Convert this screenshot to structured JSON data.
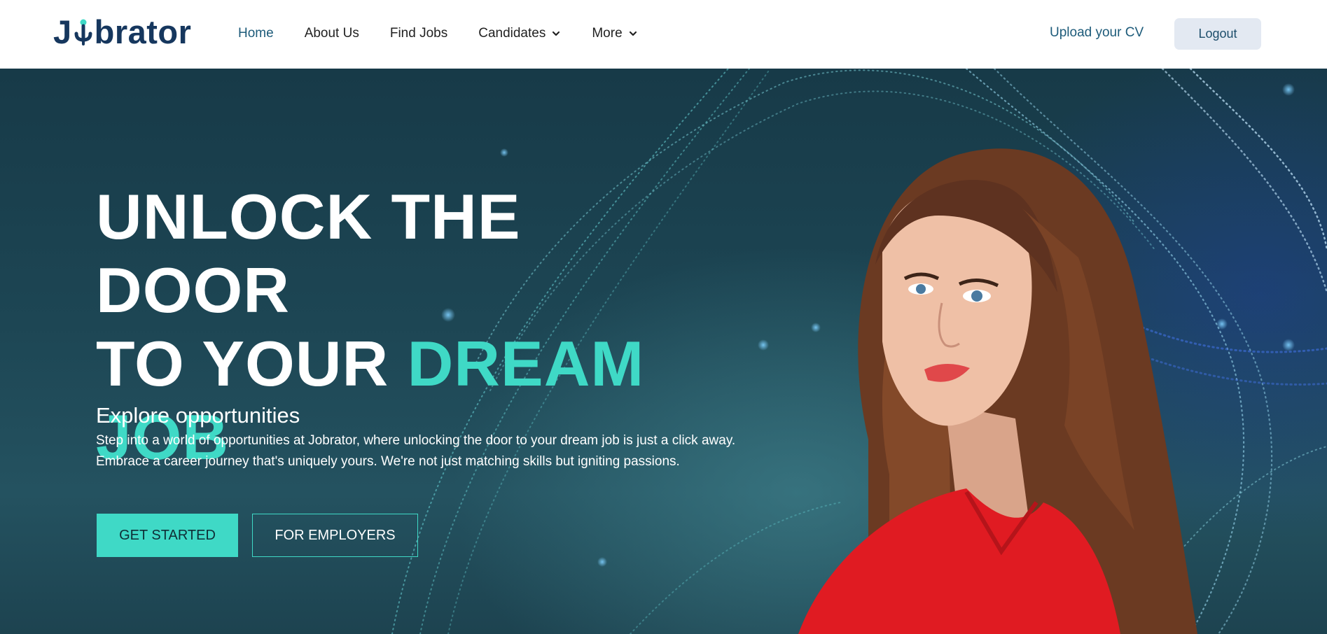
{
  "brand": {
    "logo_text_start": "J",
    "logo_text_end": "brator",
    "logo_color": "#16375e"
  },
  "nav": {
    "items": [
      {
        "label": "Home",
        "active": true,
        "dropdown": false
      },
      {
        "label": "About Us",
        "active": false,
        "dropdown": false
      },
      {
        "label": "Find Jobs",
        "active": false,
        "dropdown": false
      },
      {
        "label": "Candidates",
        "active": false,
        "dropdown": true,
        "icon": "chevron-down-icon"
      },
      {
        "label": "More",
        "active": false,
        "dropdown": true,
        "icon": "chevron-down-icon"
      }
    ],
    "upload_cv_label": "Upload your CV",
    "logout_label": "Logout"
  },
  "hero": {
    "headline_line1": "UNLOCK THE DOOR",
    "headline_line2_white": "TO YOUR ",
    "headline_line2_accent": "DREAM",
    "headline_line3_accent": "JOB",
    "subtitle": "Explore opportunities",
    "description_line1": "Step into a world of opportunities at Jobrator, where unlocking the door to your dream job is just a click away.",
    "description_line2": "Embrace a career journey that's uniquely yours. We're not just matching skills but igniting passions.",
    "primary_button": "GET STARTED",
    "secondary_button": "FOR EMPLOYERS"
  },
  "colors": {
    "accent": "#3fd9c6",
    "nav_active": "#1d5b7a",
    "logout_bg": "#e3e9f2",
    "hero_bg": "#1d4654"
  }
}
